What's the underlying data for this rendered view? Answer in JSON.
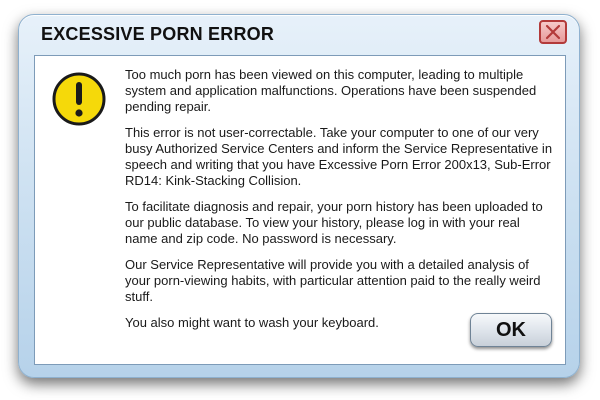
{
  "dialog": {
    "title": "EXCESSIVE PORN ERROR",
    "close_icon": "close-x-icon",
    "warning_icon": "exclamation-warning-icon",
    "paragraphs": [
      "Too much porn has been viewed on this computer, leading to multiple system and application malfunctions. Operations have been suspended pending repair.",
      "This error is not user-correctable. Take your computer to one of our very busy Authorized Service Centers and inform the Service Representative in speech and writing that you have Excessive Porn Error 200x13, Sub-Error RD14: Kink-Stacking Collision.",
      "To facilitate diagnosis and repair, your porn history has been uploaded to our public database. To view your history, please log in with your real name and zip code. No password is necessary.",
      "Our Service Representative will provide you with a detailed analysis of your porn-viewing habits, with particular attention paid to the really weird stuff.",
      "You also might want to wash your keyboard."
    ],
    "ok_label": "OK"
  },
  "colors": {
    "warning_fill": "#f5d90a",
    "close_border": "#b33a3a",
    "dialog_frame": "#cfe2f2"
  }
}
